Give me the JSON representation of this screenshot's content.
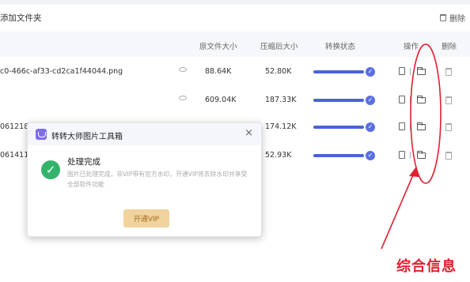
{
  "toolbar": {
    "add_folder": "添加文件夹",
    "delete_all": "删除"
  },
  "table": {
    "headers": {
      "original_size": "原文件大小",
      "compressed_size": "压缩后大小",
      "status": "转换状态",
      "action": "操作",
      "delete": "删除"
    },
    "rows": [
      {
        "filename": "c0-466c-af33-cd2ca1f44044.png",
        "original_size": "88.64K",
        "compressed_size": "52.80K",
        "progress": 1.0
      },
      {
        "filename": "",
        "original_size": "609.04K",
        "compressed_size": "187.33K",
        "progress": 1.0
      },
      {
        "filename": "06121820",
        "original_size": "",
        "compressed_size": "174.12K",
        "progress": 1.0
      },
      {
        "filename": "0614111",
        "original_size": "",
        "compressed_size": "52.93K",
        "progress": 1.0
      }
    ]
  },
  "dialog": {
    "title": "转转大师图片工具箱",
    "heading": "处理完成",
    "description": "图片已处理完成，非VIP带有官方水印，开通VIP将去除水印并享受全部软件功能",
    "vip_button": "开通VIP"
  },
  "annotation": {
    "color": "#e0202f"
  },
  "watermark": "综合信息"
}
